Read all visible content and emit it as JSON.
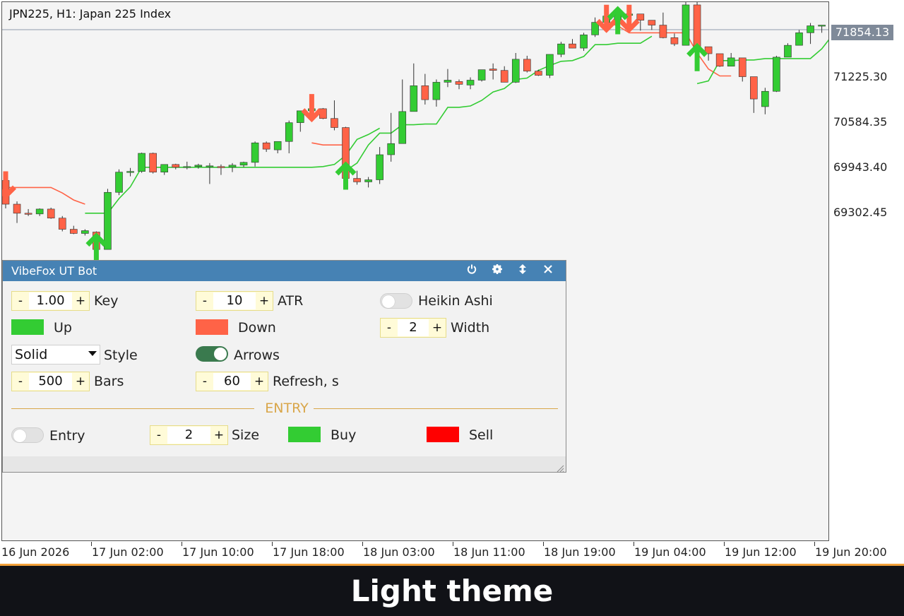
{
  "chart": {
    "title": "JPN225, H1:  Japan 225 Index",
    "current_price": "71854.13",
    "price_labels": [
      "71225.30",
      "70584.35",
      "69943.40",
      "69302.45"
    ],
    "time_labels": [
      "16 Jun 2026",
      "17 Jun 02:00",
      "17 Jun 10:00",
      "17 Jun 18:00",
      "18 Jun 03:00",
      "18 Jun 11:00",
      "18 Jun 19:00",
      "19 Jun 04:00",
      "19 Jun 12:00",
      "19 Jun 20:00"
    ],
    "colors": {
      "up": "#33cc33",
      "down": "#ff6347",
      "background": "#f4f4f4"
    }
  },
  "chart_data": {
    "type": "candlestick",
    "candles": [
      [
        69690,
        69720,
        69290,
        69350
      ],
      [
        69350,
        69390,
        69080,
        69220
      ],
      [
        69220,
        69280,
        69180,
        69210
      ],
      [
        69210,
        69290,
        69180,
        69280
      ],
      [
        69280,
        69300,
        69140,
        69150
      ],
      [
        69150,
        69180,
        68960,
        68990
      ],
      [
        68990,
        69040,
        68920,
        68930
      ],
      [
        68930,
        68990,
        68900,
        68970
      ],
      [
        68950,
        68960,
        68640,
        68700
      ],
      [
        68700,
        69570,
        68700,
        69520
      ],
      [
        69520,
        69850,
        69480,
        69810
      ],
      [
        69810,
        69870,
        69750,
        69820
      ],
      [
        69820,
        70090,
        69800,
        70080
      ],
      [
        70080,
        70090,
        69790,
        69810
      ],
      [
        69810,
        69920,
        69770,
        69920
      ],
      [
        69920,
        69930,
        69850,
        69880
      ],
      [
        69880,
        69960,
        69850,
        69890
      ],
      [
        69890,
        69930,
        69860,
        69910
      ],
      [
        69890,
        69940,
        69640,
        69900
      ],
      [
        69890,
        69920,
        69770,
        69880
      ],
      [
        69880,
        69940,
        69810,
        69910
      ],
      [
        69910,
        69960,
        69880,
        69950
      ],
      [
        69950,
        70250,
        69890,
        70230
      ],
      [
        70230,
        70250,
        70100,
        70140
      ],
      [
        70130,
        70240,
        70080,
        70250
      ],
      [
        70250,
        70550,
        70080,
        70520
      ],
      [
        70520,
        70680,
        70390,
        70690
      ],
      [
        70690,
        70830,
        70560,
        70720
      ],
      [
        70720,
        70730,
        70570,
        70580
      ],
      [
        70580,
        70840,
        70410,
        70450
      ],
      [
        70450,
        70460,
        69660,
        69720
      ],
      [
        69720,
        69830,
        69630,
        69670
      ],
      [
        69670,
        69740,
        69590,
        69700
      ],
      [
        69700,
        70170,
        69640,
        70060
      ],
      [
        70060,
        70660,
        69960,
        70220
      ],
      [
        70220,
        71140,
        70240,
        70680
      ],
      [
        70680,
        71370,
        70920,
        71050
      ],
      [
        71050,
        71220,
        70780,
        70850
      ],
      [
        70850,
        71140,
        70750,
        71100
      ],
      [
        71100,
        71290,
        71030,
        71130
      ],
      [
        71110,
        71140,
        71000,
        71070
      ],
      [
        71060,
        71170,
        71000,
        71130
      ],
      [
        71130,
        71240,
        71110,
        71280
      ],
      [
        71290,
        71370,
        71140,
        71270
      ],
      [
        71270,
        71330,
        71100,
        71100
      ],
      [
        71100,
        71520,
        71090,
        71430
      ],
      [
        71430,
        71480,
        71240,
        71260
      ],
      [
        71260,
        71280,
        71190,
        71200
      ],
      [
        71200,
        71500,
        71160,
        71500
      ],
      [
        71500,
        71680,
        71460,
        71650
      ],
      [
        71650,
        71720,
        71590,
        71590
      ],
      [
        71590,
        71810,
        71550,
        71780
      ],
      [
        71780,
        72030,
        71750,
        71960
      ],
      [
        71960,
        72110,
        71840,
        72050
      ],
      [
        71940,
        72080,
        71890,
        72060
      ],
      [
        72060,
        72110,
        72000,
        72080
      ],
      [
        72080,
        72070,
        71840,
        71990
      ],
      [
        71990,
        71990,
        71850,
        71920
      ],
      [
        71920,
        72100,
        71730,
        71740
      ],
      [
        71740,
        71800,
        71620,
        71650
      ],
      [
        71630,
        72380,
        71650,
        72210
      ],
      [
        72210,
        72280,
        71360,
        71610
      ],
      [
        71610,
        71520,
        71410,
        71510
      ],
      [
        71510,
        71480,
        71320,
        71330
      ],
      [
        71330,
        71520,
        71340,
        71450
      ],
      [
        71450,
        71420,
        71110,
        71180
      ],
      [
        71180,
        71020,
        70660,
        70860
      ],
      [
        70750,
        71020,
        70640,
        70970
      ],
      [
        70970,
        71480,
        70960,
        71460
      ],
      [
        71460,
        71660,
        71470,
        71630
      ],
      [
        71630,
        71850,
        71680,
        71810
      ],
      [
        71810,
        71950,
        71650,
        71910
      ],
      [
        71910,
        71920,
        71810,
        71920
      ],
      [
        71920,
        71980,
        71770,
        71760
      ],
      [
        71760,
        71850,
        71700,
        71830
      ],
      [
        71830,
        72110,
        71820,
        72110
      ],
      [
        72110,
        72150,
        71990,
        72050
      ],
      [
        72050,
        72090,
        71960,
        72030
      ],
      [
        71920,
        72080,
        71980,
        72030
      ],
      [
        72030,
        72030,
        71880,
        71940
      ]
    ],
    "trailing_stop": {
      "down_1": [
        69590,
        69590,
        69590,
        69590,
        69590,
        69510,
        69410,
        69350
      ],
      "up_1": [
        69220,
        69220,
        69220,
        69430,
        69600
      ],
      "up_2": [
        69600,
        69880,
        69880,
        69880,
        69880,
        69880,
        69880,
        69880,
        69880,
        69880,
        69880,
        69880,
        69880,
        69880,
        69880,
        69880,
        69880,
        69890,
        69920,
        70050,
        70280,
        70350,
        70440
      ],
      "down_2": [
        70230,
        70200,
        70200,
        70200
      ],
      "up_3": [
        69830,
        69940,
        70200,
        70370,
        70370,
        70490,
        70490,
        70500,
        70500,
        70740,
        70740,
        70760,
        70840,
        70960,
        71010,
        71140,
        71160,
        71270,
        71340,
        71400,
        71410,
        71470,
        71640,
        71640,
        71660,
        71660,
        71660,
        71760
      ],
      "down_3": [
        71960,
        71910,
        71810,
        71810,
        71810,
        71810,
        71810,
        71810,
        71520,
        71290,
        71190,
        71190
      ],
      "up_4": [
        71080,
        71120,
        71410,
        71410,
        71420,
        71420,
        71440,
        71440,
        71440,
        71440,
        71440,
        71580,
        71790,
        71790,
        71810,
        71810,
        71810,
        71810,
        71810
      ]
    },
    "signals": [
      {
        "type": "sell",
        "index": 0
      },
      {
        "type": "buy",
        "index": 8
      },
      {
        "type": "sell",
        "index": 27
      },
      {
        "type": "buy",
        "index": 30
      },
      {
        "type": "sell",
        "index": 53
      },
      {
        "type": "sell",
        "index": 55
      },
      {
        "type": "buy",
        "index": 54
      },
      {
        "type": "buy",
        "index": 61
      }
    ],
    "y_range": [
      68600,
      72250
    ]
  },
  "panel": {
    "title": "VibeFox UT Bot",
    "key": {
      "minus": "-",
      "value": "1.00",
      "plus": "+",
      "label": "Key"
    },
    "atr": {
      "minus": "-",
      "value": "10",
      "plus": "+",
      "label": "ATR"
    },
    "heikin": {
      "label": "Heikin Ashi",
      "enabled": false
    },
    "up": {
      "label": "Up",
      "color": "#33cc33"
    },
    "down": {
      "label": "Down",
      "color": "#ff6347"
    },
    "width": {
      "minus": "-",
      "value": "2",
      "plus": "+",
      "label": "Width"
    },
    "style": {
      "value": "Solid",
      "label": "Style"
    },
    "arrows": {
      "label": "Arrows",
      "enabled": true
    },
    "bars": {
      "minus": "-",
      "value": "500",
      "plus": "+",
      "label": "Bars"
    },
    "refresh": {
      "minus": "-",
      "value": "60",
      "plus": "+",
      "label": "Refresh, s"
    },
    "section_title": "ENTRY",
    "entry": {
      "label": "Entry",
      "enabled": false
    },
    "size": {
      "minus": "-",
      "value": "2",
      "plus": "+",
      "label": "Size"
    },
    "buy": {
      "label": "Buy",
      "color": "#33cc33"
    },
    "sell": {
      "label": "Sell",
      "color": "#ff0000"
    }
  },
  "footer": {
    "text": "Light theme"
  }
}
